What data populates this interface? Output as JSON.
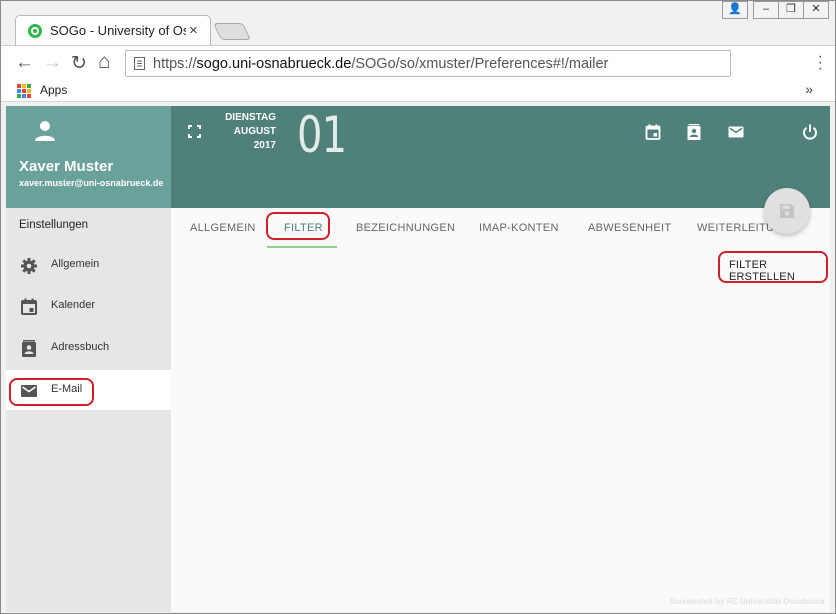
{
  "browser": {
    "tab_title": "SOGo - University of Osnabrück",
    "tab_close": "×",
    "url_prefix": "https://",
    "url_host": "sogo.uni-osnabrueck.de",
    "url_path": "/SOGo/so/xmuster/Preferences#!/mailer",
    "bookmarks_apps": "Apps",
    "bookmarks_more": "»",
    "window_buttons": [
      "👤",
      "–",
      "❐",
      "✕"
    ],
    "nav_back": "←",
    "nav_forward": "→",
    "nav_reload": "↻",
    "nav_home": "⌂"
  },
  "user": {
    "name": "Xaver Muster",
    "email": "xaver.muster@uni-osnabrueck.de"
  },
  "sidebar": {
    "heading": "Einstellungen",
    "items": [
      {
        "label": "Allgemein",
        "icon": "gear-icon"
      },
      {
        "label": "Kalender",
        "icon": "calendar-icon"
      },
      {
        "label": "Adressbuch",
        "icon": "contacts-icon"
      },
      {
        "label": "E-Mail",
        "icon": "mail-icon",
        "active": true
      }
    ]
  },
  "header": {
    "weekday": "DIENSTAG",
    "month": "AUGUST",
    "year": "2017",
    "day": "01",
    "icons": [
      "calendar-icon",
      "contacts-icon",
      "mail-icon",
      "power-icon"
    ]
  },
  "tabs": [
    {
      "label": "ALLGEMEIN"
    },
    {
      "label": "FILTER",
      "active": true
    },
    {
      "label": "BEZEICHNUNGEN"
    },
    {
      "label": "IMAP-KONTEN"
    },
    {
      "label": "ABWESENHEIT"
    },
    {
      "label": "WEITERLEITUNG"
    }
  ],
  "actions": {
    "filter_create": "FILTER ERSTELLEN"
  },
  "watermark": "Screenshot by RZ Universität Osnabrück",
  "colors": {
    "header": "#4f807a",
    "user_card": "#6aa29b",
    "annotation": "#d0212b",
    "tab_underline": "#8fd08b"
  }
}
